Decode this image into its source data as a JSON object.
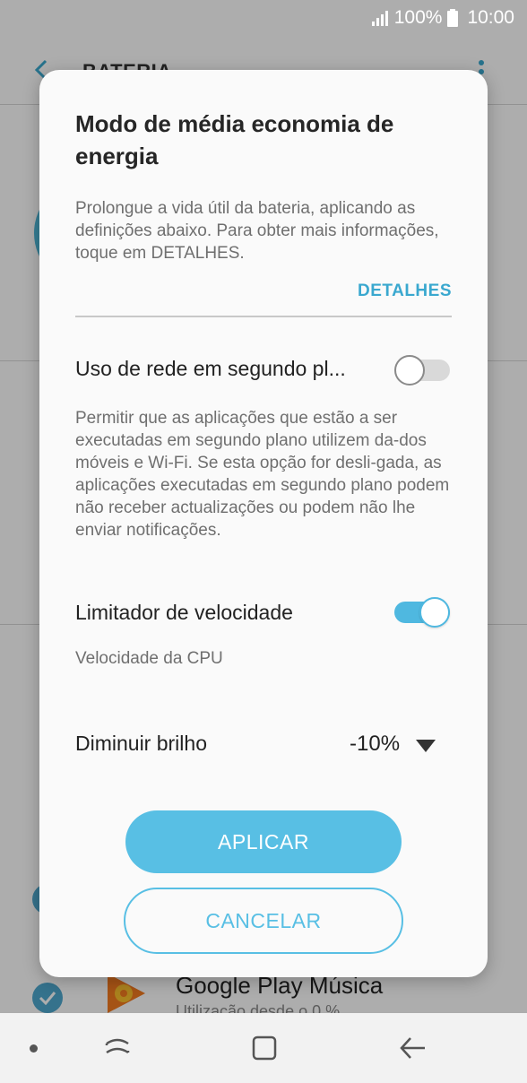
{
  "status_bar": {
    "battery_percent": "100%",
    "time": "10:00"
  },
  "background": {
    "header_title": "BATERIA",
    "app_name": "Google Play Música",
    "app_sub": "Utilização desde o 0 %"
  },
  "dialog": {
    "title": "Modo de média economia de energia",
    "description": "Prolongue a vida útil da bateria, aplicando as definições abaixo. Para obter mais informações, toque em DETALHES.",
    "details_link": "DETALHES",
    "background_network": {
      "label": "Uso de rede em segundo pl...",
      "enabled": false,
      "description": "Permitir que as aplicações que estão a ser executadas em segundo plano utilizem da-dos móveis e Wi-Fi. Se esta opção for desli-gada, as aplicações executadas em segundo plano podem não receber actualizações ou podem não lhe enviar notificações."
    },
    "speed_limiter": {
      "label": "Limitador de velocidade",
      "enabled": true,
      "sub": "Velocidade da CPU"
    },
    "brightness": {
      "label": "Diminuir brilho",
      "value": "-10%"
    },
    "apply_button": "APLICAR",
    "cancel_button": "CANCELAR"
  },
  "colors": {
    "accent": "#58bfe4",
    "link": "#3aa8cf",
    "toggle_on": "#4fb8e0"
  }
}
